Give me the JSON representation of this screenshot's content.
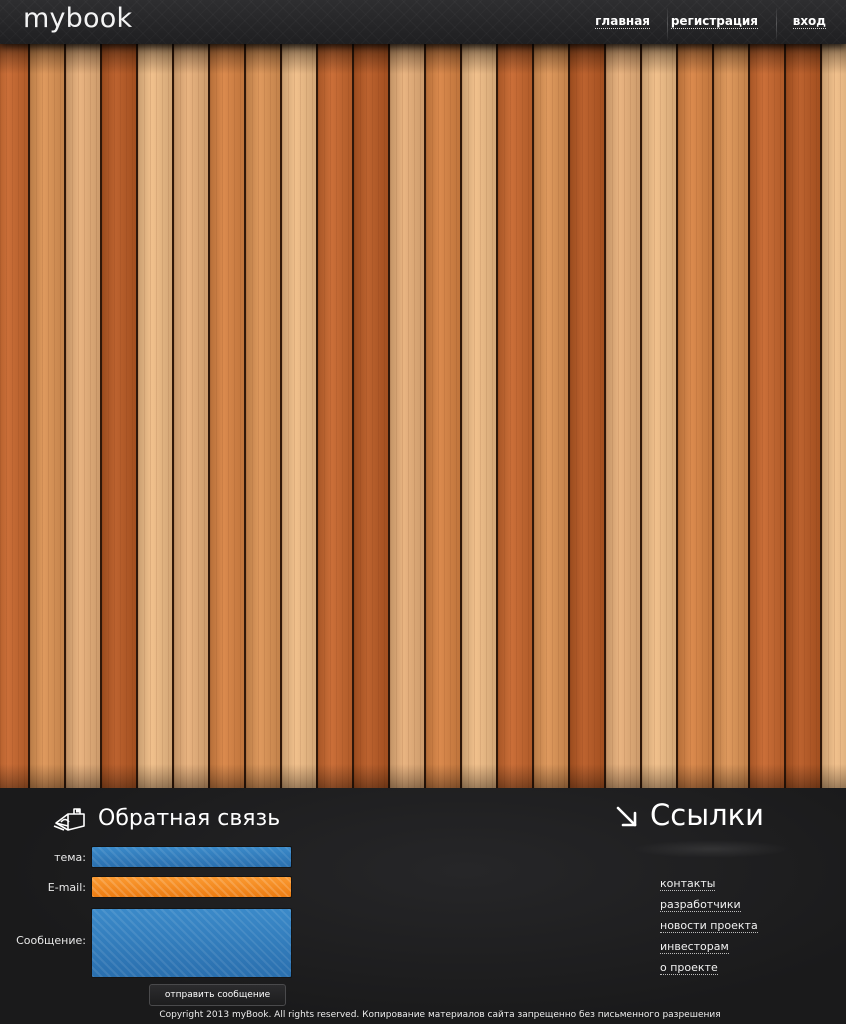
{
  "header": {
    "logo": "mybook",
    "nav": [
      {
        "label": "главная"
      },
      {
        "label": "регистрация"
      },
      {
        "label": "вход"
      }
    ]
  },
  "hero": {
    "background": "wood-planks",
    "wood_colors": [
      "#e8b07a",
      "#c8672e",
      "#dd9455",
      "#f0bd86",
      "#b95a24",
      "#d98444"
    ]
  },
  "feedback": {
    "icon": "mailbox-icon",
    "title": "Обратная связь",
    "fields": {
      "subject": {
        "label": "тема:",
        "value": "",
        "placeholder": ""
      },
      "email": {
        "label": "E-mail:",
        "value": "",
        "placeholder": ""
      },
      "message": {
        "label": "Сообщение:",
        "value": "",
        "placeholder": ""
      }
    },
    "submit_label": "отправить сообщение"
  },
  "links": {
    "icon": "arrow-down-right-icon",
    "title": "Ссылки",
    "items": [
      {
        "label": "контакты"
      },
      {
        "label": "разработчики"
      },
      {
        "label": "новости проекта"
      },
      {
        "label": "инвесторам"
      },
      {
        "label": "о проекте"
      }
    ]
  },
  "footer": {
    "copyright": "Copyright 2013 myBook. All rights reserved. Копирование материалов сайта запрещенно без письменного разрешения"
  },
  "colors": {
    "field_blue": "#2f7dc0",
    "field_orange": "#f28a1f",
    "dark_background": "#1c1c1d"
  }
}
